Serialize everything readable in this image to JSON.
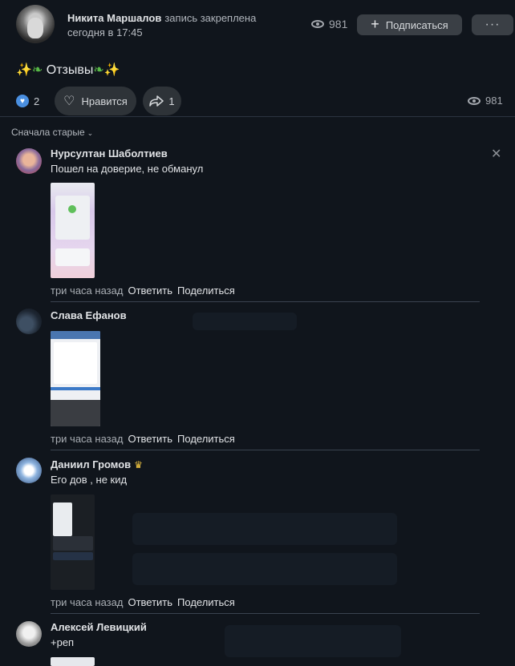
{
  "post": {
    "author": "Никита Маршалов",
    "author_note": "запись закреплена",
    "date": "сегодня в 17:45",
    "views": "981",
    "subscribe_label": "Подписаться",
    "more_label": "···",
    "title": "Отзывы",
    "title_emoji_left": "✨",
    "title_emoji_right": "✨",
    "likes": "2",
    "like_label": "Нравится",
    "shares": "1",
    "views_bottom": "981"
  },
  "comments_header": {
    "sort_label": "Сначала старые"
  },
  "comments": [
    {
      "name": "Нурсултан Шаболтиев",
      "text": "Пошел на доверие, не обманул",
      "time": "три часа назад",
      "reply": "Ответить",
      "share": "Поделиться"
    },
    {
      "name": "Слава Ефанов",
      "text": "",
      "time": "три часа назад",
      "reply": "Ответить",
      "share": "Поделиться"
    },
    {
      "name": "Даниил Громов",
      "text": "Его дов , не кид",
      "time": "три часа назад",
      "reply": "Ответить",
      "share": "Поделиться"
    },
    {
      "name": "Алексей Левицкий",
      "text": "+реп"
    }
  ],
  "colors": {
    "background": "#10151c",
    "button": "#3a3f45",
    "like_badge": "#4a8fe0"
  },
  "icons": [
    "eye-icon",
    "plus-icon",
    "more-icon",
    "heart-icon",
    "share-icon",
    "close-icon",
    "chevron-down-icon",
    "crown-icon"
  ]
}
